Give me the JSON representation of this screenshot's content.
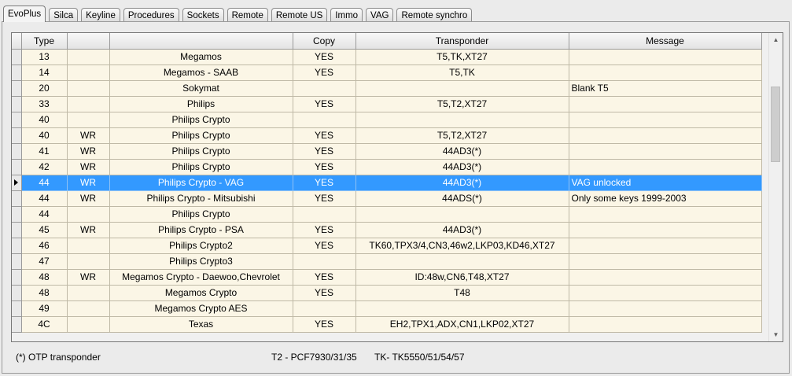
{
  "tabs": [
    "EvoPlus",
    "Silca",
    "Keyline",
    "Procedures",
    "Sockets",
    "Remote",
    "Remote US",
    "Immo",
    "VAG",
    "Remote synchro"
  ],
  "active_tab": "EvoPlus",
  "table": {
    "columns": [
      "Type",
      "",
      "",
      "Copy",
      "Transponder",
      "Message"
    ],
    "rows": [
      [
        "13",
        "",
        "Megamos",
        "YES",
        "T5,TK,XT27",
        ""
      ],
      [
        "14",
        "",
        "Megamos - SAAB",
        "YES",
        "T5,TK",
        ""
      ],
      [
        "20",
        "",
        "Sokymat",
        "",
        "",
        "Blank T5"
      ],
      [
        "33",
        "",
        "Philips",
        "YES",
        "T5,T2,XT27",
        ""
      ],
      [
        "40",
        "",
        "Philips Crypto",
        "",
        "",
        ""
      ],
      [
        "40",
        "WR",
        "Philips Crypto",
        "YES",
        "T5,T2,XT27",
        ""
      ],
      [
        "41",
        "WR",
        "Philips Crypto",
        "YES",
        "44AD3(*)",
        ""
      ],
      [
        "42",
        "WR",
        "Philips Crypto",
        "YES",
        "44AD3(*)",
        ""
      ],
      [
        "44",
        "WR",
        "Philips Crypto - VAG",
        "YES",
        "44AD3(*)",
        "VAG unlocked"
      ],
      [
        "44",
        "WR",
        "Philips Crypto - Mitsubishi",
        "YES",
        "44ADS(*)",
        "Only some keys 1999-2003"
      ],
      [
        "44",
        "",
        "Philips Crypto",
        "",
        "",
        ""
      ],
      [
        "45",
        "WR",
        "Philips Crypto - PSA",
        "YES",
        "44AD3(*)",
        ""
      ],
      [
        "46",
        "",
        "Philips Crypto2",
        "YES",
        "TK60,TPX3/4,CN3,46w2,LKP03,KD46,XT27",
        ""
      ],
      [
        "47",
        "",
        "Philips Crypto3",
        "",
        "",
        ""
      ],
      [
        "48",
        "WR",
        "Megamos Crypto - Daewoo,Chevrolet",
        "YES",
        "ID:48w,CN6,T48,XT27",
        ""
      ],
      [
        "48",
        "",
        "Megamos Crypto",
        "YES",
        "T48",
        ""
      ],
      [
        "49",
        "",
        "Megamos Crypto AES",
        "",
        "",
        ""
      ],
      [
        "4C",
        "",
        "Texas",
        "YES",
        "EH2,TPX1,ADX,CN1,LKP02,XT27",
        ""
      ]
    ],
    "selected_row": 8
  },
  "footer": {
    "otp_note": "(*) OTP transponder",
    "t2_note": "T2 - PCF7930/31/35",
    "tk_note": "TK- TK5550/51/54/57"
  },
  "colors": {
    "row_bg": "#fbf6e6",
    "selection": "#3399ff",
    "window_bg": "#ebebeb"
  }
}
